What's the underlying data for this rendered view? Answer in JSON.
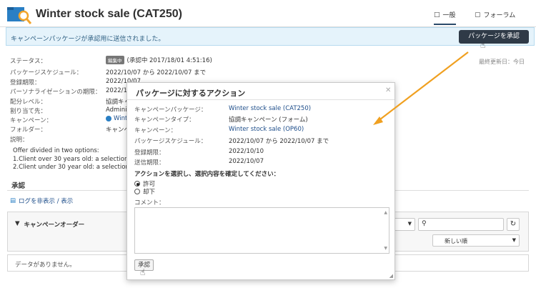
{
  "header": {
    "title": "Winter stock sale (CAT250)",
    "tabs": [
      {
        "label": "一般"
      },
      {
        "label": "フォーラム"
      }
    ]
  },
  "banner": {
    "message": "キャンペーンパッケージが承認用に送信されました。",
    "approve_button": "パッケージを承認"
  },
  "details": {
    "status_label": "ステータス：",
    "status_badge": "編集中",
    "status_text": "(承認中 2017/18/01 4:51:16)",
    "schedule_label": "パッケージスケジュール：",
    "schedule_value": "2022/10/07 から 2022/10/07 まで",
    "registration_label": "登録期限：",
    "registration_value": "2022/10/07",
    "personalization_label": "パーソナライゼーションの期限：",
    "personalization_value": "2022/10",
    "delivery_label": "配分レベル：",
    "delivery_value": "協調キャ",
    "assigned_label": "割り当て先：",
    "assigned_value": "Adminis",
    "campaign_label": "キャンペーン：",
    "campaign_value": "Winte",
    "folder_label": "フォルダー：",
    "folder_value": "キャンペ",
    "description_label": "説明：",
    "description_lines": [
      "Offer divided in two options:",
      "1.Client over 30 years old: a selection of",
      "2.Client under 30 year old: a selection of"
    ],
    "last_updated": "最終更新日：今日"
  },
  "approval": {
    "heading": "承認",
    "log_toggle": "ログを非表示 / 表示",
    "campaign_order_label": "キャンペーンオーダー",
    "sort_value": "新しい順",
    "no_data": "データがありません。"
  },
  "modal": {
    "title": "パッケージに対するアクション",
    "rows": [
      {
        "label": "キャンペーンパッケージ：",
        "value": "Winter stock sale (CAT250)"
      },
      {
        "label": "キャンペーンタイプ：",
        "value": "協調キャンペーン (フォーム)"
      },
      {
        "label": "キャンペーン：",
        "value": "Winter stock sale (OP60)"
      },
      {
        "label": "パッケージスケジュール：",
        "value": "2022/10/07 から 2022/10/07 まで"
      },
      {
        "label": "登録期限：",
        "value": "2022/10/10"
      },
      {
        "label": "送信期限：",
        "value": "2022/10/07"
      }
    ],
    "action_prompt": "アクションを選択し、選択内容を確定してください：",
    "options": [
      {
        "label": "許可",
        "selected": true
      },
      {
        "label": "却下",
        "selected": false
      }
    ],
    "comment_label": "コメント：",
    "approve_button": "承認"
  },
  "colors": {
    "accent": "#2f3a47",
    "banner_bg": "#e5f3fb",
    "link": "#1d4d8a",
    "arrow": "#f0a020"
  }
}
